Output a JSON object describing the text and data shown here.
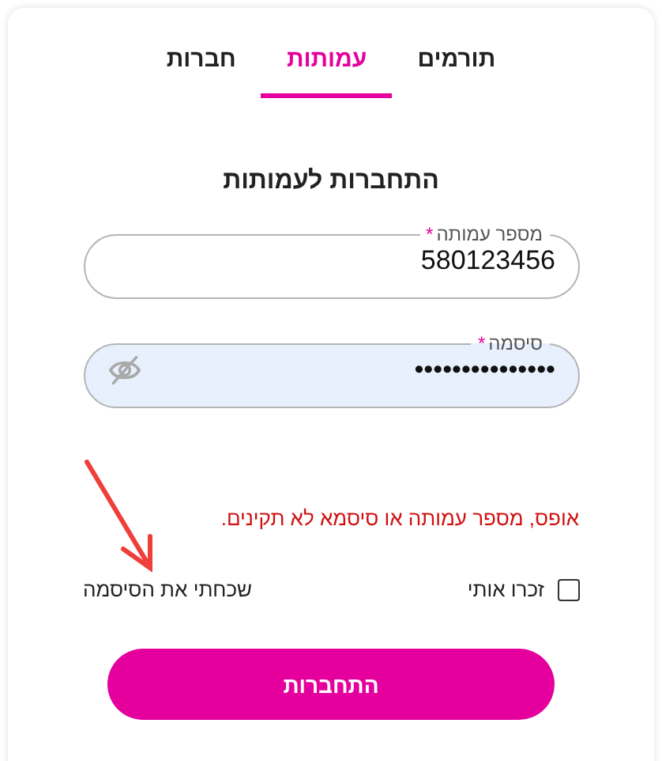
{
  "tabs": [
    {
      "label": "תורמים",
      "selected": false
    },
    {
      "label": "עמותות",
      "selected": true
    },
    {
      "label": "חברות",
      "selected": false
    }
  ],
  "title": "התחברות לעמותות",
  "fields": [
    {
      "kind": "text",
      "label": "מספר עמותה",
      "required_mark": "*",
      "value": "580123456",
      "autofilled": false
    },
    {
      "kind": "password",
      "label": "סיסמה",
      "required_mark": "*",
      "value": "•••••••••••••••",
      "autofilled": true
    }
  ],
  "error": "אופס, מספר עמותה או סיסמא לא תקינים.",
  "remember": {
    "label": "זכרו אותי",
    "checked": false
  },
  "forgot_link": "שכחתי את הסיסמה",
  "submit": "התחברות"
}
